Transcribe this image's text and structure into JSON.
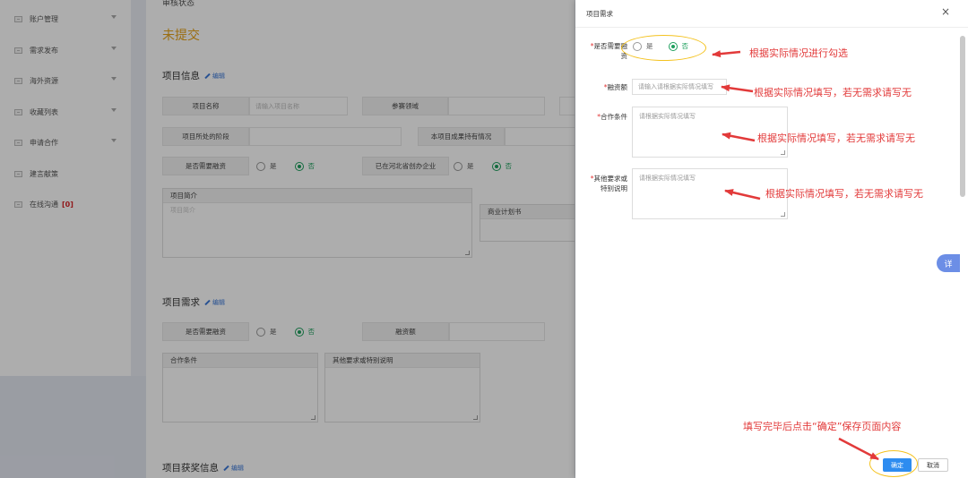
{
  "sidebar": {
    "items": [
      {
        "label": "账户管理",
        "has_chevron": true
      },
      {
        "label": "需求发布",
        "has_chevron": true
      },
      {
        "label": "海外资源",
        "has_chevron": true
      },
      {
        "label": "收藏列表",
        "has_chevron": true
      },
      {
        "label": "申请合作",
        "has_chevron": true
      },
      {
        "label": "建言献策",
        "has_chevron": false
      },
      {
        "label": "在线沟通",
        "badge": "[0]",
        "has_chevron": false
      }
    ]
  },
  "main": {
    "review_status_label": "审核状态",
    "review_status_value": "未提交",
    "edit_label": "编辑",
    "project_info": {
      "title": "项目信息",
      "name_label": "项目名称",
      "name_placeholder": "请输入项目名称",
      "field_label": "参赛领域",
      "stage_label": "项目所处的阶段",
      "outcome_label": "本项目成果持有情况",
      "financing_label": "是否需要融资",
      "hebei_label": "已在河北省创办企业",
      "yes": "是",
      "no": "否",
      "intro_label": "项目简介",
      "intro_placeholder": "项目简介",
      "bp_label": "商业计划书"
    },
    "project_needs": {
      "title": "项目需求",
      "financing_label": "是否需要融资",
      "yes": "是",
      "no": "否",
      "amount_label": "融资额",
      "coop_label": "合作条件",
      "other_label": "其他要求或特别说明"
    },
    "awards": {
      "title": "项目获奖信息"
    }
  },
  "dialog": {
    "title": "项目需求",
    "close": "×",
    "financing_label_line1": "是否需要融",
    "financing_label_line2": "资",
    "yes": "是",
    "no": "否",
    "amount_label": "融资额",
    "amount_placeholder": "请输入请根据实际情况填写",
    "coop_label": "合作条件",
    "coop_placeholder": "请根据实际情况填写",
    "other_label_line1": "其他要求或",
    "other_label_line2": "特别说明",
    "other_placeholder": "请根据实际情况填写",
    "ok": "确定",
    "cancel": "取消",
    "float_button": "详"
  },
  "annotations": {
    "a1": "根据实际情况进行勾选",
    "a2": "根据实际情况填写，若无需求请写无",
    "a3": "根据实际情况填写，若无需求请写无",
    "a4": "根据实际情况填写，若无需求请写无",
    "a5": "填写完毕后点击“确定”保存页面内容",
    "color": "#e23a3a",
    "highlight_color": "#f4c21f"
  }
}
